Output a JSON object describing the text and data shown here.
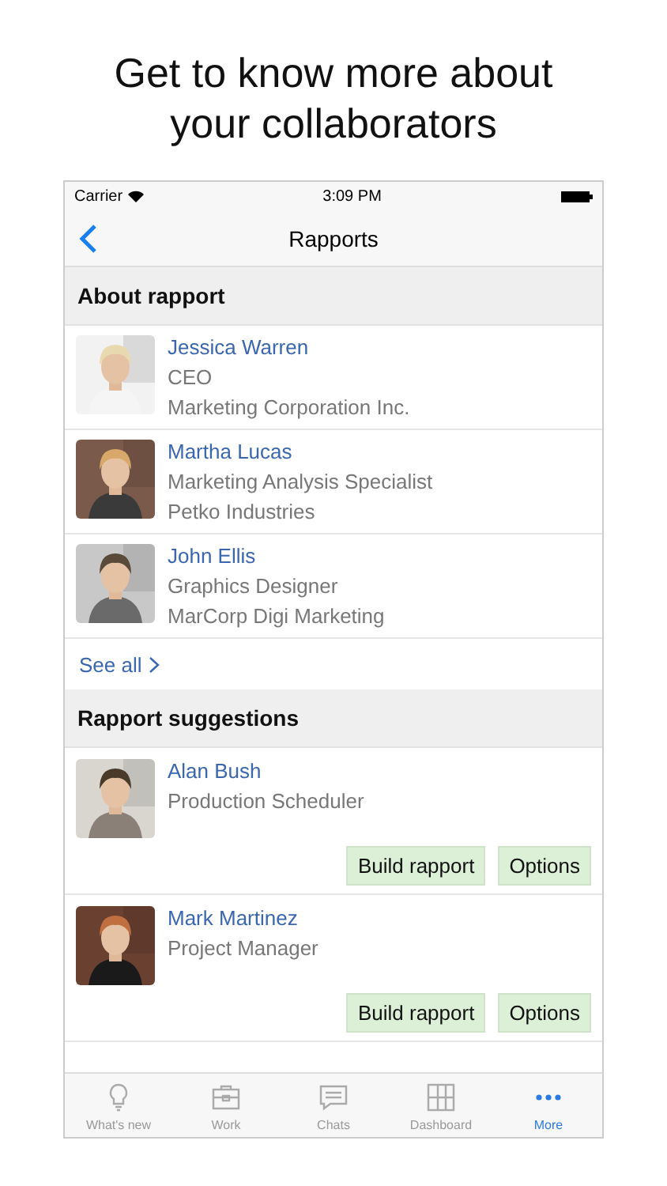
{
  "headline": "Get to know more about your collaborators",
  "status_bar": {
    "carrier": "Carrier",
    "time": "3:09 PM"
  },
  "nav": {
    "title": "Rapports"
  },
  "about": {
    "title": "About rapport",
    "people": [
      {
        "name": "Jessica Warren",
        "role": "CEO",
        "company": "Marketing Corporation Inc."
      },
      {
        "name": "Martha Lucas",
        "role": "Marketing Analysis Specialist",
        "company": "Petko Industries"
      },
      {
        "name": "John Ellis",
        "role": "Graphics Designer",
        "company": "MarCorp Digi Marketing"
      }
    ],
    "see_all": "See all"
  },
  "suggestions": {
    "title": "Rapport suggestions",
    "people": [
      {
        "name": "Alan Bush",
        "role": "Production Scheduler",
        "actions": [
          "Build rapport",
          "Options"
        ]
      },
      {
        "name": "Mark Martinez",
        "role": "Project Manager",
        "actions": [
          "Build rapport",
          "Options"
        ]
      }
    ]
  },
  "tabs": [
    {
      "label": "What's new",
      "selected": false
    },
    {
      "label": "Work",
      "selected": false
    },
    {
      "label": "Chats",
      "selected": false
    },
    {
      "label": "Dashboard",
      "selected": false
    },
    {
      "label": "More",
      "selected": true
    }
  ]
}
